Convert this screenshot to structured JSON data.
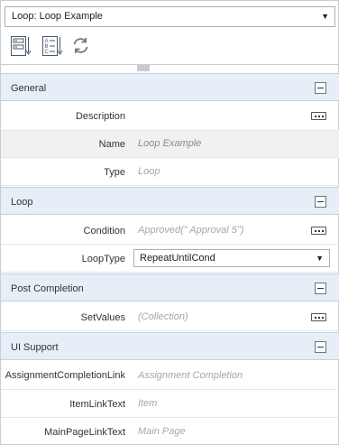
{
  "selector": {
    "value": "Loop: Loop Example"
  },
  "toolbar": {
    "items": [
      {
        "name": "categorized-view",
        "icon": "categorized-list-icon"
      },
      {
        "name": "alphabetical-view",
        "icon": "alphabetical-sort-icon"
      },
      {
        "name": "refresh",
        "icon": "refresh-icon"
      }
    ]
  },
  "sections": {
    "general": {
      "title": "General",
      "rows": {
        "description": {
          "label": "Description",
          "value": ""
        },
        "name": {
          "label": "Name",
          "value": "Loop Example"
        },
        "type": {
          "label": "Type",
          "value": "Loop"
        }
      }
    },
    "loop": {
      "title": "Loop",
      "rows": {
        "condition": {
          "label": "Condition",
          "value": "Approved(\" Approval 5\")"
        },
        "looptype": {
          "label": "LoopType",
          "value": "RepeatUntilCond"
        }
      }
    },
    "post": {
      "title": "Post Completion",
      "rows": {
        "setvalues": {
          "label": "SetValues",
          "value": "(Collection)"
        }
      }
    },
    "ui": {
      "title": "UI Support",
      "rows": {
        "assignment": {
          "label": "AssignmentCompletionLink",
          "value": "Assignment Completion"
        },
        "itemlink": {
          "label": "ItemLinkText",
          "value": "Item"
        },
        "mainpage": {
          "label": "MainPageLinkText",
          "value": "Main Page"
        }
      }
    }
  },
  "colors": {
    "section_header_bg": "#e6eef8",
    "alt_row_bg": "#f1f1f1",
    "placeholder_text": "#a6a6a6",
    "icon_blue": "#4a5a6a"
  }
}
